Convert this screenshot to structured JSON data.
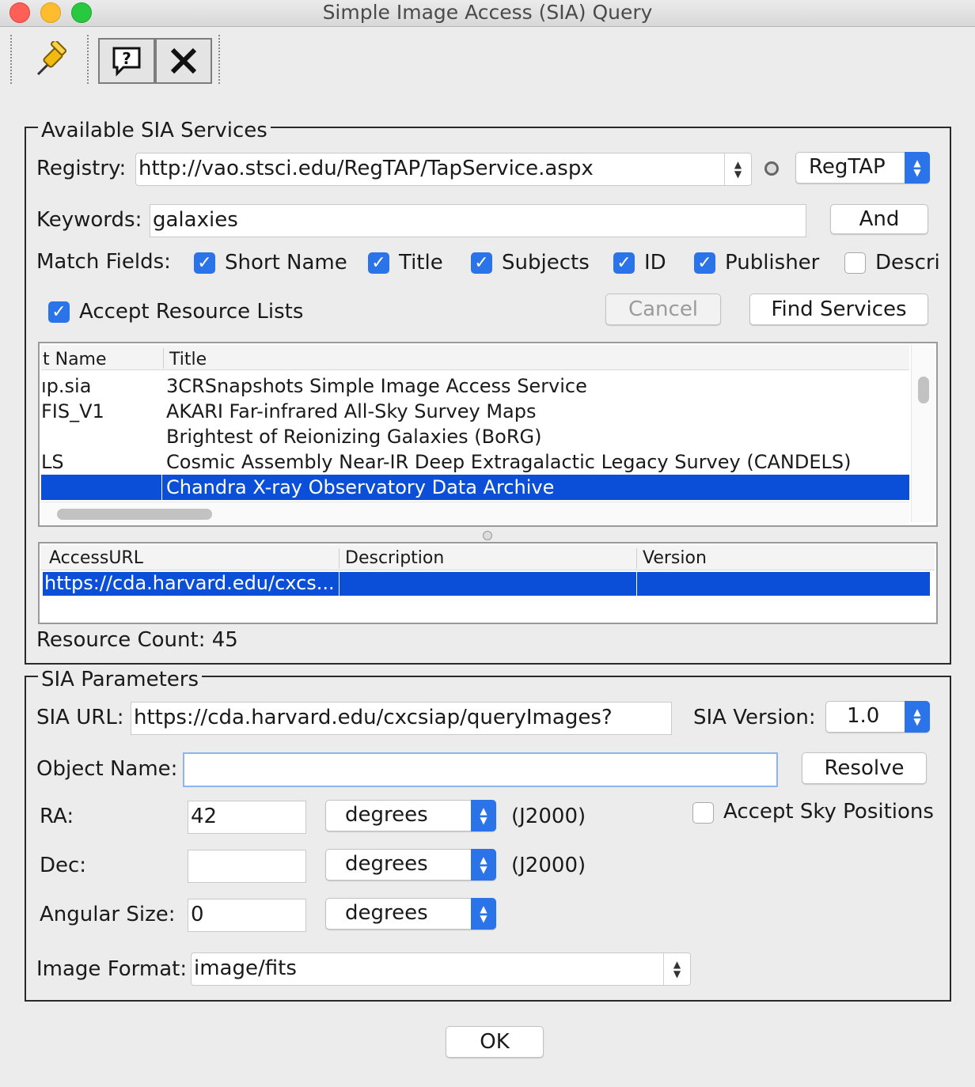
{
  "window": {
    "title": "Simple Image Access (SIA) Query"
  },
  "toolbar": {
    "pin_icon": "pushpin-icon",
    "help_icon": "help-icon",
    "close_icon": "close-x-icon"
  },
  "services": {
    "legend": "Available SIA Services",
    "registry_label": "Registry:",
    "registry_url": "http://vao.stsci.edu/RegTAP/TapService.aspx",
    "registry_protocol": "RegTAP",
    "keywords_label": "Keywords:",
    "keywords_value": "galaxies",
    "and_or_button": "And",
    "match_fields_label": "Match Fields:",
    "match_fields": [
      {
        "label": "Short Name",
        "checked": true
      },
      {
        "label": "Title",
        "checked": true
      },
      {
        "label": "Subjects",
        "checked": true
      },
      {
        "label": "ID",
        "checked": true
      },
      {
        "label": "Publisher",
        "checked": true
      },
      {
        "label": "Descri",
        "checked": false
      }
    ],
    "accept_resource_lists": "Accept Resource Lists",
    "cancel_button": "Cancel",
    "find_services_button": "Find Services",
    "table": {
      "columns": [
        "t Name",
        "Title"
      ],
      "rows": [
        [
          "ıp.sia",
          "3CRSnapshots Simple Image Access Service"
        ],
        [
          "FIS_V1",
          "AKARI Far-infrared All-Sky Survey Maps"
        ],
        [
          "",
          "Brightest of Reionizing Galaxies (BoRG)"
        ],
        [
          "LS",
          "Cosmic Assembly Near-IR Deep Extragalactic Legacy Survey (CANDELS)"
        ],
        [
          "",
          "Chandra X-ray Observatory Data Archive"
        ]
      ],
      "selected_index": 4
    },
    "detail_table": {
      "columns": [
        "AccessURL",
        "Description",
        "Version"
      ],
      "rows": [
        [
          "https://cda.harvard.edu/cxcs...",
          "",
          ""
        ]
      ]
    },
    "resource_count": "Resource Count: 45"
  },
  "params": {
    "legend": "SIA Parameters",
    "sia_url_label": "SIA URL:",
    "sia_url_value": "https://cda.harvard.edu/cxcsiap/queryImages?",
    "sia_version_label": "SIA Version:",
    "sia_version_value": "1.0",
    "object_name_label": "Object Name:",
    "object_name_value": "",
    "resolve_button": "Resolve",
    "ra_label": "RA:",
    "ra_value": "42",
    "ra_units": "degrees",
    "ra_epoch": "(J2000)",
    "dec_label": "Dec:",
    "dec_value": "",
    "dec_units": "degrees",
    "dec_epoch": "(J2000)",
    "size_label": "Angular Size:",
    "size_value": "0",
    "size_units": "degrees",
    "accept_sky_positions": "Accept Sky Positions",
    "image_format_label": "Image Format:",
    "image_format_value": "image/fits"
  },
  "ok_button": "OK",
  "colors": {
    "accent": "#2a73e8",
    "selection": "#0b4fd8"
  }
}
